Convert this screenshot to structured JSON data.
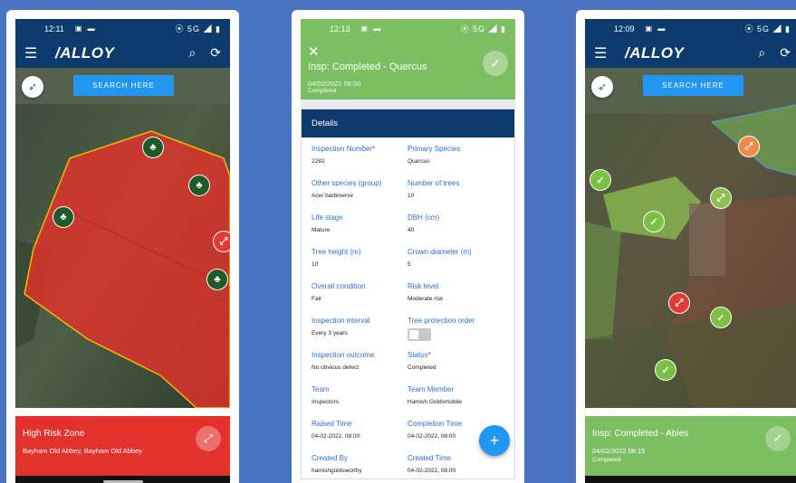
{
  "phone1": {
    "status": {
      "time": "12:11",
      "icons": "▣ ▬",
      "right": "⦿ 5G ◢ ▮"
    },
    "appbar": {
      "logo": "/ALLOY",
      "menu_icon": "hamburger-icon",
      "search_icon": "search-icon",
      "sync_icon": "sync-icon"
    },
    "map": {
      "search_label": "SEARCH HERE"
    },
    "card": {
      "title": "High Risk Zone",
      "subtitle": "Bayham Old Abbey, Bayham Old Abbey"
    }
  },
  "phone2": {
    "status": {
      "time": "12:13",
      "icons": "▣ ▬",
      "right": "⦿ 5G ◢ ▮"
    },
    "header": {
      "title": "Insp: Completed - Quercus",
      "date": "04/02/2022 08:00",
      "status": "Completed"
    },
    "details_title": "Details",
    "fields": [
      {
        "label": "Inspection Number*",
        "value": "2282"
      },
      {
        "label": "Primary Species",
        "value": "Quercus"
      },
      {
        "label": "Other species (group)",
        "value": "Acer barbinerve"
      },
      {
        "label": "Number of trees",
        "value": "10"
      },
      {
        "label": "Life stage",
        "value": "Mature"
      },
      {
        "label": "DBH (cm)",
        "value": "40"
      },
      {
        "label": "Tree height (m)",
        "value": "10"
      },
      {
        "label": "Crown diameter (m)",
        "value": "5"
      },
      {
        "label": "Overall condition",
        "value": "Fair"
      },
      {
        "label": "Risk level",
        "value": "Moderate risk"
      },
      {
        "label": "Inspection interval",
        "value": "Every 3 years"
      },
      {
        "label": "Tree protection order",
        "value": ""
      },
      {
        "label": "Inspection outcome",
        "value": "No obvious defect"
      },
      {
        "label": "Status*",
        "value": "Completed"
      },
      {
        "label": "Team",
        "value": "Inspectors"
      },
      {
        "label": "Team Member",
        "value": "Hamish Goldsmobile"
      },
      {
        "label": "Raised Time",
        "value": "04-02-2022, 08:00"
      },
      {
        "label": "Completion Time",
        "value": "04-02-2022, 08:00"
      },
      {
        "label": "Created By",
        "value": "hamishgoldsworthy"
      },
      {
        "label": "Created Time",
        "value": "04-02-2022, 08:00"
      }
    ],
    "fab_label": "+"
  },
  "phone3": {
    "status": {
      "time": "12:09",
      "icons": "▣ ▬",
      "right": "⦿ 5G ◢ ▮"
    },
    "appbar": {
      "logo": "/ALLOY"
    },
    "map": {
      "search_label": "SEARCH HERE"
    },
    "card": {
      "title": "Insp: Completed - Abies",
      "date": "04/02/2022 08:15",
      "status": "Completed"
    }
  },
  "colors": {
    "navy": "#0d3b6e",
    "green": "#7cbf63",
    "red": "#e3322b",
    "blue": "#2196f3",
    "background": "#4a73c2"
  }
}
